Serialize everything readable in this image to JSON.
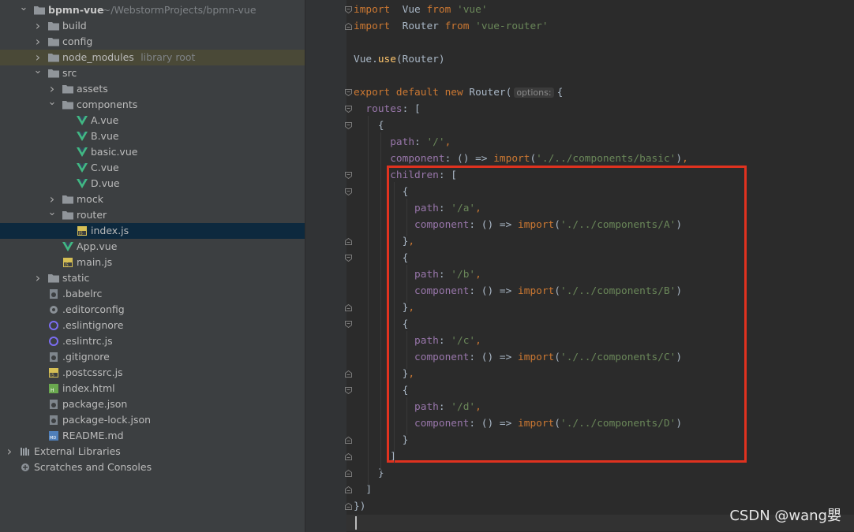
{
  "project": {
    "name": "bpmn-vue",
    "path": "~/WebstormProjects/bpmn-vue",
    "library_root_label": "library root",
    "items": [
      {
        "label": "build",
        "type": "folder",
        "depth": 1,
        "expanded": false
      },
      {
        "label": "config",
        "type": "folder",
        "depth": 1,
        "expanded": false
      },
      {
        "label": "node_modules",
        "type": "folder",
        "depth": 1,
        "expanded": false,
        "library": true
      },
      {
        "label": "src",
        "type": "folder",
        "depth": 1,
        "expanded": true
      },
      {
        "label": "assets",
        "type": "folder",
        "depth": 2,
        "expanded": false
      },
      {
        "label": "components",
        "type": "folder",
        "depth": 2,
        "expanded": true
      },
      {
        "label": "A.vue",
        "type": "vue",
        "depth": 3
      },
      {
        "label": "B.vue",
        "type": "vue",
        "depth": 3
      },
      {
        "label": "basic.vue",
        "type": "vue",
        "depth": 3
      },
      {
        "label": "C.vue",
        "type": "vue",
        "depth": 3
      },
      {
        "label": "D.vue",
        "type": "vue",
        "depth": 3
      },
      {
        "label": "mock",
        "type": "folder",
        "depth": 2,
        "expanded": false
      },
      {
        "label": "router",
        "type": "folder",
        "depth": 2,
        "expanded": true
      },
      {
        "label": "index.js",
        "type": "js",
        "depth": 3,
        "selected": true
      },
      {
        "label": "App.vue",
        "type": "vue",
        "depth": 2
      },
      {
        "label": "main.js",
        "type": "js",
        "depth": 2
      },
      {
        "label": "static",
        "type": "folder",
        "depth": 1,
        "expanded": false
      },
      {
        "label": ".babelrc",
        "type": "config",
        "depth": 1
      },
      {
        "label": ".editorconfig",
        "type": "gear",
        "depth": 1
      },
      {
        "label": ".eslintignore",
        "type": "eslint",
        "depth": 1
      },
      {
        "label": ".eslintrc.js",
        "type": "eslint",
        "depth": 1
      },
      {
        "label": ".gitignore",
        "type": "config",
        "depth": 1
      },
      {
        "label": ".postcssrc.js",
        "type": "js",
        "depth": 1
      },
      {
        "label": "index.html",
        "type": "html",
        "depth": 1
      },
      {
        "label": "package.json",
        "type": "config",
        "depth": 1
      },
      {
        "label": "package-lock.json",
        "type": "config",
        "depth": 1
      },
      {
        "label": "README.md",
        "type": "md",
        "depth": 1
      }
    ],
    "external_libraries": "External Libraries",
    "scratches": "Scratches and Consoles"
  },
  "editor": {
    "current_line": 32,
    "lines": [
      {
        "n": 1,
        "fold": "open",
        "tokens": [
          [
            "kw",
            "import"
          ],
          [
            "",
            "  Vue "
          ],
          [
            "kw",
            "from"
          ],
          [
            "str",
            " 'vue'"
          ]
        ]
      },
      {
        "n": 2,
        "fold": "close",
        "tokens": [
          [
            "kw",
            "import"
          ],
          [
            "",
            "  Router "
          ],
          [
            "kw",
            "from"
          ],
          [
            "str",
            " 'vue-router'"
          ]
        ]
      },
      {
        "n": 3,
        "tokens": []
      },
      {
        "n": 4,
        "tokens": [
          [
            "",
            "Vue."
          ],
          [
            "fn",
            "use"
          ],
          [
            "",
            "(Router)"
          ]
        ]
      },
      {
        "n": 5,
        "tokens": []
      },
      {
        "n": 6,
        "fold": "open",
        "tokens": [
          [
            "kw",
            "export default new "
          ],
          [
            "",
            "Router("
          ],
          [
            "hint",
            "options:"
          ],
          [
            "",
            ""
          ],
          [
            "",
            "{"
          ]
        ]
      },
      {
        "n": 7,
        "fold": "open",
        "tokens": [
          [
            "prop",
            "  routes"
          ],
          [
            "",
            ": ["
          ]
        ]
      },
      {
        "n": 8,
        "fold": "open",
        "tokens": [
          [
            "",
            "    {"
          ]
        ]
      },
      {
        "n": 9,
        "tokens": [
          [
            "prop",
            "      path"
          ],
          [
            "",
            ": "
          ],
          [
            "str",
            "'/'"
          ],
          [
            "kw",
            ","
          ]
        ]
      },
      {
        "n": 10,
        "tokens": [
          [
            "prop",
            "      component"
          ],
          [
            "",
            ": () => "
          ],
          [
            "kw",
            "import"
          ],
          [
            "",
            "("
          ],
          [
            "str",
            "'./../components/basic'"
          ],
          [
            "",
            ")"
          ],
          [
            "kw",
            ","
          ]
        ]
      },
      {
        "n": 11,
        "fold": "open",
        "tokens": [
          [
            "prop",
            "      children"
          ],
          [
            "",
            ": ["
          ]
        ]
      },
      {
        "n": 12,
        "fold": "open",
        "tokens": [
          [
            "",
            "        {"
          ]
        ]
      },
      {
        "n": 13,
        "tokens": [
          [
            "prop",
            "          path"
          ],
          [
            "",
            ": "
          ],
          [
            "str",
            "'/a'"
          ],
          [
            "kw",
            ","
          ]
        ]
      },
      {
        "n": 14,
        "tokens": [
          [
            "prop",
            "          component"
          ],
          [
            "",
            ": () => "
          ],
          [
            "kw",
            "import"
          ],
          [
            "",
            "("
          ],
          [
            "str",
            "'./../components/A'"
          ],
          [
            "",
            ")"
          ]
        ]
      },
      {
        "n": 15,
        "fold": "close",
        "tokens": [
          [
            "",
            "        }"
          ],
          [
            "kw",
            ","
          ]
        ]
      },
      {
        "n": 16,
        "fold": "open",
        "tokens": [
          [
            "",
            "        {"
          ]
        ]
      },
      {
        "n": 17,
        "tokens": [
          [
            "prop",
            "          path"
          ],
          [
            "",
            ": "
          ],
          [
            "str",
            "'/b'"
          ],
          [
            "kw",
            ","
          ]
        ]
      },
      {
        "n": 18,
        "tokens": [
          [
            "prop",
            "          component"
          ],
          [
            "",
            ": () => "
          ],
          [
            "kw",
            "import"
          ],
          [
            "",
            "("
          ],
          [
            "str",
            "'./../components/B'"
          ],
          [
            "",
            ")"
          ]
        ]
      },
      {
        "n": 19,
        "fold": "close",
        "tokens": [
          [
            "",
            "        }"
          ],
          [
            "kw",
            ","
          ]
        ]
      },
      {
        "n": 20,
        "fold": "open",
        "tokens": [
          [
            "",
            "        {"
          ]
        ]
      },
      {
        "n": 21,
        "tokens": [
          [
            "prop",
            "          path"
          ],
          [
            "",
            ": "
          ],
          [
            "str",
            "'/c'"
          ],
          [
            "kw",
            ","
          ]
        ]
      },
      {
        "n": 22,
        "tokens": [
          [
            "prop",
            "          component"
          ],
          [
            "",
            ": () => "
          ],
          [
            "kw",
            "import"
          ],
          [
            "",
            "("
          ],
          [
            "str",
            "'./../components/C'"
          ],
          [
            "",
            ")"
          ]
        ]
      },
      {
        "n": 23,
        "fold": "close",
        "tokens": [
          [
            "",
            "        }"
          ],
          [
            "kw",
            ","
          ]
        ]
      },
      {
        "n": 24,
        "fold": "open",
        "tokens": [
          [
            "",
            "        {"
          ]
        ]
      },
      {
        "n": 25,
        "tokens": [
          [
            "prop",
            "          path"
          ],
          [
            "",
            ": "
          ],
          [
            "str",
            "'/d'"
          ],
          [
            "kw",
            ","
          ]
        ]
      },
      {
        "n": 26,
        "tokens": [
          [
            "prop",
            "          component"
          ],
          [
            "",
            ": () => "
          ],
          [
            "kw",
            "import"
          ],
          [
            "",
            "("
          ],
          [
            "str",
            "'./../components/D'"
          ],
          [
            "",
            ")"
          ]
        ]
      },
      {
        "n": 27,
        "fold": "close",
        "tokens": [
          [
            "",
            "        }"
          ]
        ]
      },
      {
        "n": 28,
        "fold": "close",
        "tokens": [
          [
            "",
            "      ]"
          ]
        ]
      },
      {
        "n": 29,
        "fold": "close",
        "tokens": [
          [
            "",
            "    }"
          ]
        ]
      },
      {
        "n": 30,
        "fold": "close",
        "tokens": [
          [
            "",
            "  ]"
          ]
        ]
      },
      {
        "n": 31,
        "fold": "close",
        "tokens": [
          [
            "",
            "})"
          ]
        ]
      },
      {
        "n": 32,
        "tokens": []
      }
    ]
  },
  "annotation": {
    "color": "#e0321f"
  },
  "watermark": "CSDN @wang嬰"
}
